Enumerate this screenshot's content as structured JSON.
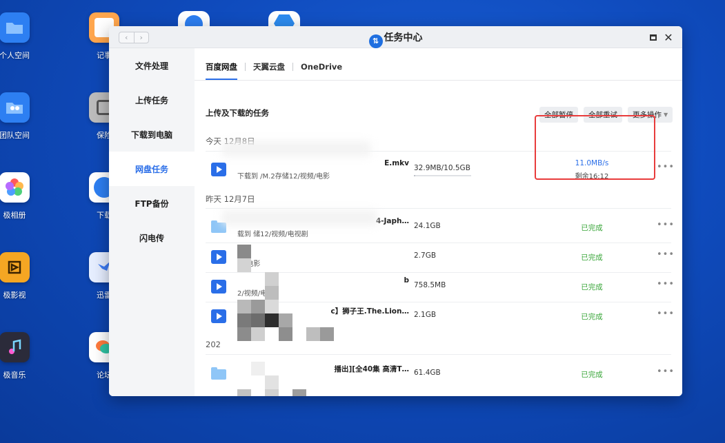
{
  "desktop": {
    "icons": [
      {
        "label": "个人空间",
        "icon": "folder-icon",
        "color": "#2d7ff2"
      },
      {
        "label": "团队空间",
        "icon": "team-folder-icon",
        "color": "#2d7ff2"
      },
      {
        "label": "极相册",
        "icon": "photos-icon",
        "color": "#ffffff"
      },
      {
        "label": "极影视",
        "icon": "video-icon",
        "color": "#f5a623"
      },
      {
        "label": "极音乐",
        "icon": "music-icon",
        "color": "#7a3cf0"
      },
      {
        "label": "记事",
        "icon": "notes-icon",
        "color": "#ffa64d"
      },
      {
        "label": "保险",
        "icon": "safe-icon",
        "color": "#bcbcbc"
      },
      {
        "label": "下载",
        "icon": "download-globe-icon",
        "color": "#2d7ff2"
      },
      {
        "label": "迅雷",
        "icon": "thunder-icon",
        "color": "#e6eeff"
      },
      {
        "label": "论坛",
        "icon": "forum-icon",
        "color": "#ffffff"
      }
    ]
  },
  "window": {
    "title": "任务中心",
    "title_icon": "task-center-icon",
    "nav_back": "‹",
    "nav_forward": "›",
    "close_symbol": "✕"
  },
  "sidebar": {
    "items": [
      {
        "label": "文件处理"
      },
      {
        "label": "上传任务"
      },
      {
        "label": "下载到电脑"
      },
      {
        "label": "网盘任务",
        "active": true
      },
      {
        "label": "FTP备份"
      },
      {
        "label": "闪电传"
      }
    ]
  },
  "tabs": [
    {
      "label": "百度网盘",
      "active": true
    },
    {
      "label": "天翼云盘"
    },
    {
      "label": "OneDrive"
    }
  ],
  "section": {
    "title": "上传及下载的任务",
    "buttons": {
      "pause_all": "全部暂停",
      "retry_all": "全部重试",
      "more_ops": "更多操作"
    }
  },
  "groups": [
    {
      "date": "今天 12月8日"
    },
    {
      "date": "昨天 12月7日"
    },
    {
      "date": "202"
    }
  ],
  "tasks": [
    {
      "name": "E.mkv",
      "path": "下载到 /M.2存储12/视频/电影",
      "size": "32.9MB/10.5GB",
      "progress": 0.003,
      "speed": "11.0MB/s",
      "remaining": "剩余16:12",
      "status": "",
      "type": "video"
    },
    {
      "name": "4-Japh…",
      "path": "载到 储12/视频/电视剧",
      "size": "24.1GB",
      "status": "已完成",
      "type": "folder"
    },
    {
      "name": "",
      "path": "频/电影",
      "size": "2.7GB",
      "status": "已完成",
      "type": "video"
    },
    {
      "name": "b",
      "path": "2/视频/电影",
      "size": "758.5MB",
      "status": "已完成",
      "type": "video"
    },
    {
      "name": "c】狮子王.The.Lion…",
      "path": "",
      "size": "2.1GB",
      "status": "已完成",
      "type": "video"
    },
    {
      "name": "播出][全40集 高清T…",
      "path": "",
      "size": "61.4GB",
      "status": "已完成",
      "type": "folder"
    }
  ],
  "more_symbol": "•••",
  "colors": {
    "accent": "#2a6ee8",
    "done": "#3aa63a",
    "highlight_box": "#e83b3b"
  }
}
